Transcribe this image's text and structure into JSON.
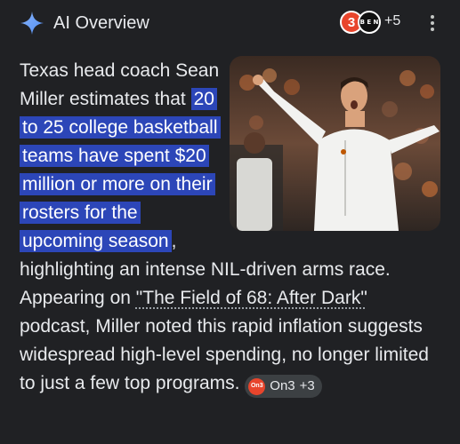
{
  "header": {
    "title": "AI Overview",
    "source_badge_1": "3",
    "source_badge_2": "B E N",
    "source_count": "+5"
  },
  "summary": {
    "intro": "Texas head coach Sean Miller estimates that ",
    "highlight": "20 to 25 college basketball teams have spent $20 million or more on their rosters for the upcoming season",
    "middle": ", highlighting an intense NIL-driven arms race. Appearing on ",
    "link_text": "\"The Field of 68: After Dark\"",
    "outro": " podcast, Miller noted this rapid inflation suggests widespread high-level spending, no longer limited to just a few top programs. ",
    "citation": {
      "logo": "On3",
      "label": "On3",
      "count": "+3"
    }
  },
  "image": {
    "subject": "coach-on-sideline"
  },
  "colors": {
    "background": "#202124",
    "highlight": "#2c46b8",
    "accent": "#4f8df5"
  }
}
